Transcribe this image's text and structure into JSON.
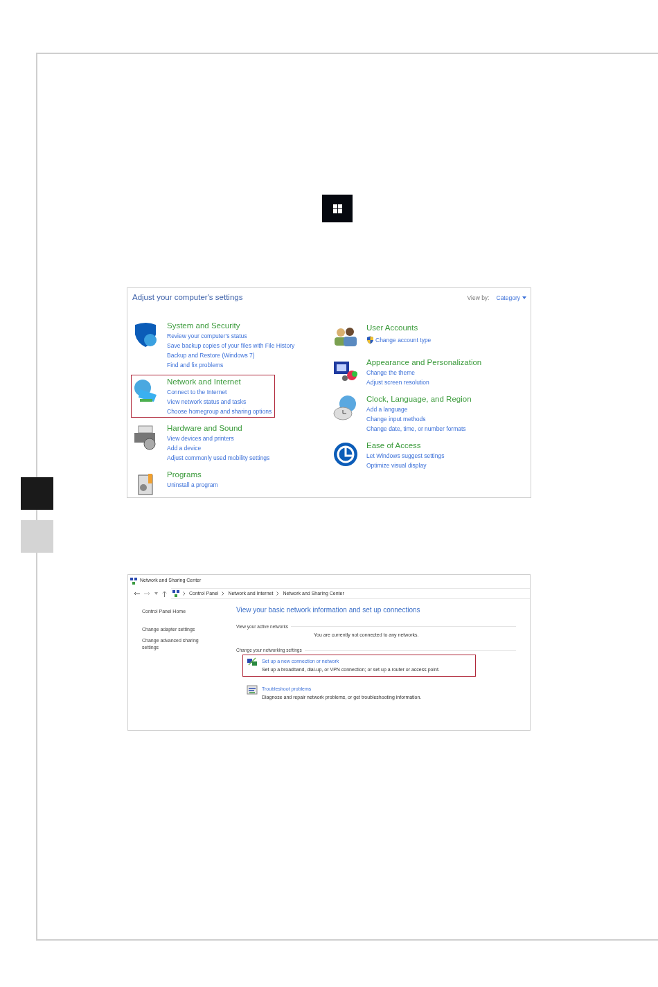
{
  "control_panel": {
    "title": "Adjust your computer's settings",
    "view_by_label": "View by:",
    "view_by_value": "Category",
    "columns": [
      [
        {
          "kind": "security",
          "name": "System and Security",
          "highlighted": false,
          "links": [
            {
              "text": "Review your computer's status",
              "shield": false
            },
            {
              "text": "Save backup copies of your files with File History",
              "shield": false
            },
            {
              "text": "Backup and Restore (Windows 7)",
              "shield": false
            },
            {
              "text": "Find and fix problems",
              "shield": false
            }
          ]
        },
        {
          "kind": "network",
          "name": "Network and Internet",
          "highlighted": true,
          "links": [
            {
              "text": "Connect to the Internet",
              "shield": false
            },
            {
              "text": "View network status and tasks",
              "shield": false
            },
            {
              "text": "Choose homegroup and sharing options",
              "shield": false
            }
          ]
        },
        {
          "kind": "hardware",
          "name": "Hardware and Sound",
          "highlighted": false,
          "links": [
            {
              "text": "View devices and printers",
              "shield": false
            },
            {
              "text": "Add a device",
              "shield": false
            },
            {
              "text": "Adjust commonly used mobility settings",
              "shield": false
            }
          ]
        },
        {
          "kind": "programs",
          "name": "Programs",
          "highlighted": false,
          "links": [
            {
              "text": "Uninstall a program",
              "shield": false
            }
          ]
        }
      ],
      [
        {
          "kind": "accounts",
          "name": "User Accounts",
          "highlighted": false,
          "links": [
            {
              "text": "Change account type",
              "shield": true
            }
          ]
        },
        {
          "kind": "appearance",
          "name": "Appearance and Personalization",
          "highlighted": false,
          "links": [
            {
              "text": "Change the theme",
              "shield": false
            },
            {
              "text": "Adjust screen resolution",
              "shield": false
            }
          ]
        },
        {
          "kind": "clock",
          "name": "Clock, Language, and Region",
          "highlighted": false,
          "links": [
            {
              "text": "Add a language",
              "shield": false
            },
            {
              "text": "Change input methods",
              "shield": false
            },
            {
              "text": "Change date, time, or number formats",
              "shield": false
            }
          ]
        },
        {
          "kind": "access",
          "name": "Ease of Access",
          "highlighted": false,
          "links": [
            {
              "text": "Let Windows suggest settings",
              "shield": false
            },
            {
              "text": "Optimize visual display",
              "shield": false
            }
          ]
        }
      ]
    ]
  },
  "sharing_center": {
    "title": "Network and Sharing Center",
    "breadcrumb": [
      "Control Panel",
      "Network and Internet",
      "Network and Sharing Center"
    ],
    "sidebar": [
      {
        "text": "Control Panel Home"
      },
      {
        "text": "Change adapter settings"
      },
      {
        "text": "Change advanced sharing settings"
      }
    ],
    "heading": "View your basic network information and set up connections",
    "active_networks": {
      "label": "View your active networks",
      "message": "You are currently not connected to any networks."
    },
    "settings_label": "Change your networking settings",
    "tasks": [
      {
        "kind": "new_connection",
        "title": "Set up a new connection or network",
        "description": "Set up a broadband, dial-up, or VPN connection; or set up a router or access point.",
        "highlighted": true
      },
      {
        "kind": "troubleshoot",
        "title": "Troubleshoot problems",
        "description": "Diagnose and repair network problems, or get troubleshooting information.",
        "highlighted": false
      }
    ]
  }
}
